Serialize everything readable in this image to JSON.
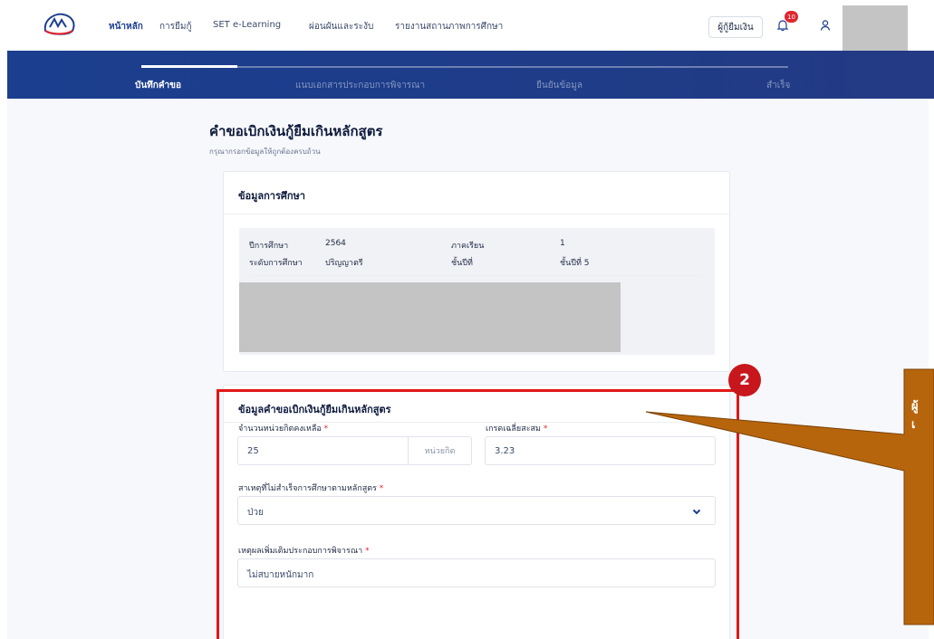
{
  "nav": {
    "items": [
      "หน้าหลัก",
      "การยืมกู้",
      "SET e-Learning",
      "ผ่อนผันและระงับ",
      "รายงานสถานภาพการศึกษา"
    ],
    "role_button": "ผู้กู้ยืมเงิน",
    "notification_count": "10"
  },
  "stepper": {
    "steps": [
      "บันทึกคำขอ",
      "แนบเอกสารประกอบการพิจารณา",
      "ยืนยันข้อมูล",
      "สำเร็จ"
    ],
    "active_index": 0
  },
  "page": {
    "title": "คำขอเบิกเงินกู้ยืมเกินหลักสูตร",
    "subtitle": "กรุณากรอกข้อมูลให้ถูกต้องครบถ้วน"
  },
  "education": {
    "title": "ข้อมูลการศึกษา",
    "year_label": "ปีการศึกษา",
    "year_value": "2564",
    "semester_label": "ภาคเรียน",
    "semester_value": "1",
    "level_label": "ระดับการศึกษา",
    "level_value": "ปริญญาตรี",
    "grade_label": "ชั้นปีที่",
    "grade_value": "ชั้นปีที่ 5"
  },
  "request": {
    "title": "ข้อมูลคำขอเบิกเงินกู้ยืมเกินหลักสูตร",
    "credits_label": "จำนวนหน่วยกิตคงเหลือ",
    "credits_value": "25",
    "credits_unit": "หน่วยกิต",
    "gpa_label": "เกรดเฉลี่ยสะสม",
    "gpa_value": "3.23",
    "reason_label": "สาเหตุที่ไม่สำเร็จการศึกษาตามหลักสูตร",
    "reason_value": "ป่วย",
    "extra_label": "เหตุผลเพิ่มเติมประกอบการพิจารณา",
    "extra_value": "ไม่สบายหนักมาก",
    "required_mark": "*"
  },
  "annotation": {
    "step_number": "2",
    "callout_text": [
      "ผู้",
      "เ"
    ],
    "highlight_color": "#e01717",
    "callout_color": "#b7650d"
  },
  "colors": {
    "brand_navy": "#1b3e8e",
    "required_red": "#e0262f"
  }
}
